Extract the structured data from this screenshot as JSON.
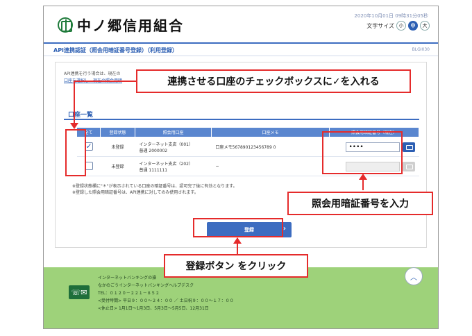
{
  "header": {
    "bank_name": "中ノ郷信用組合",
    "datetime": "2020年10月01日 09時31分05秒",
    "font_size_label": "文字サイズ",
    "font_sizes": [
      "小",
      "中",
      "大"
    ]
  },
  "titlebar": {
    "title": "API連携認証（照会用暗証番号登録）（利用登録）",
    "screen_id": "BLGI030"
  },
  "intro": {
    "line1": "API連携を行う場合は、現在の",
    "line2": "口座を選択し、現在の照会用暗"
  },
  "section": {
    "title": "口座一覧"
  },
  "table": {
    "headers": [
      "全て",
      "登録状態",
      "照会用口座",
      "口座メモ",
      "照会用暗証番号（現在）"
    ],
    "rows": [
      {
        "checked": true,
        "status": "未登録",
        "branch": "インターネット支店（001）",
        "account": "普通 2000002",
        "memo": "口座メモ567890123456789 0",
        "password": "••••",
        "enabled": true
      },
      {
        "checked": false,
        "status": "未登録",
        "branch": "インターネット支店（202）",
        "account": "普通 1111111",
        "memo": "−",
        "password": "",
        "enabled": false
      }
    ]
  },
  "notes": {
    "line1": "※登録状態欄に\"＊\"が表示されている口座の暗証番号は、認可完了後に有効となります。",
    "line2": "※登録した照会用暗証番号は、API連携に対してのみ使用されます。"
  },
  "register_button": {
    "label": "登録",
    "chevron": "›"
  },
  "footer": {
    "line1": "インターネットバンキングの操",
    "line2": "なかのごうインターネットバンキングヘルプデスク",
    "tel": "TEL：０１２０－２２１－８５２",
    "hours": "<受付時間> 平日９：００～２４：００ ／ 土日祝９：００～１７：００",
    "holidays": "<休止日> 1月1日～1月3日、5月3日～5月5日、12月31日",
    "tel_icon": "phone-mail-icon",
    "scroll_top": "︿"
  },
  "annotations": {
    "checkbox_instruction": "連携させる口座のチェックボックスに✓を入れる",
    "password_instruction": "照会用暗証番号を入力",
    "button_instruction": "登録ボタン をクリック",
    "color": "#e52b2b"
  }
}
